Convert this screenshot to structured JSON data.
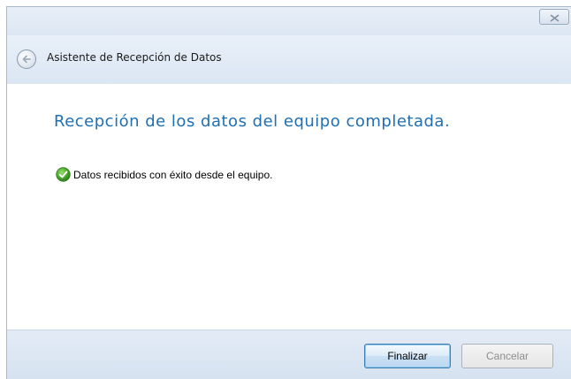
{
  "window": {
    "close_icon": "close-icon"
  },
  "header": {
    "back_icon": "back-arrow-icon",
    "title": "Asistente de Recepción de Datos"
  },
  "content": {
    "heading": "Recepción de los datos del equipo completada.",
    "status": {
      "icon": "check-success-icon",
      "text": "Datos recibidos con éxito desde el equipo."
    }
  },
  "footer": {
    "finish_label": "Finalizar",
    "cancel_label": "Cancelar"
  },
  "colors": {
    "heading": "#1f6fb3",
    "success": "#4caa2e",
    "focus_border": "#3c7fb1"
  }
}
